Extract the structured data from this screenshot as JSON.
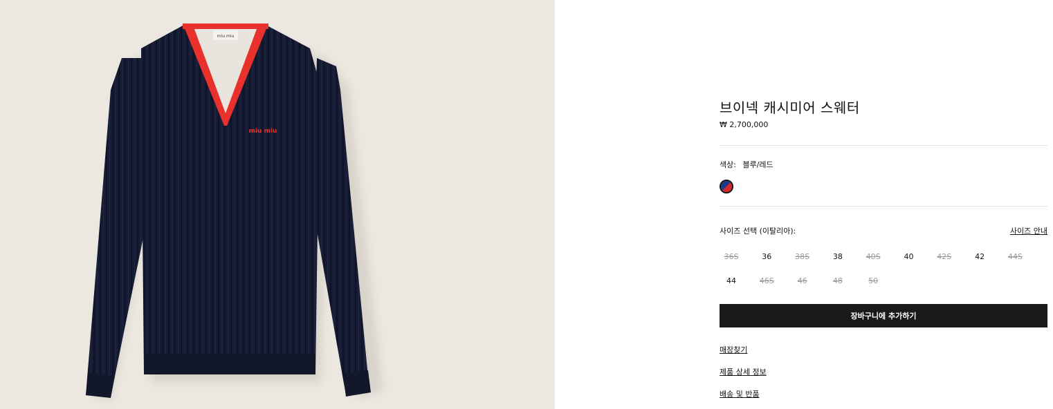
{
  "product": {
    "title": "브이넥 캐시미어 스웨터",
    "price": "₩ 2,700,000",
    "image_label": "miu miu",
    "color": {
      "label": "색상:",
      "value": "블루/레드",
      "swatch_colors": [
        "#1c3a8a",
        "#d9262b"
      ]
    },
    "size": {
      "label": "사이즈 선택 (이탈리아):",
      "guide_label": "사이즈 안내",
      "options": [
        {
          "label": "36S",
          "available": false
        },
        {
          "label": "36",
          "available": true
        },
        {
          "label": "38S",
          "available": false
        },
        {
          "label": "38",
          "available": true
        },
        {
          "label": "40S",
          "available": false
        },
        {
          "label": "40",
          "available": true
        },
        {
          "label": "42S",
          "available": false
        },
        {
          "label": "42",
          "available": true
        },
        {
          "label": "44S",
          "available": false
        },
        {
          "label": "44",
          "available": true
        },
        {
          "label": "46S",
          "available": false
        },
        {
          "label": "46",
          "available": false
        },
        {
          "label": "48",
          "available": false
        },
        {
          "label": "50",
          "available": false
        }
      ]
    },
    "add_to_cart_label": "장바구니에 추가하기",
    "links": {
      "store_finder": "매장찾기",
      "product_details": "제품 상세 정보",
      "shipping_returns": "배송 및 반품"
    }
  },
  "colors": {
    "sweater_body": "#161c33",
    "trim": "#e8302c",
    "background": "#ece8e1",
    "button": "#18191b"
  }
}
